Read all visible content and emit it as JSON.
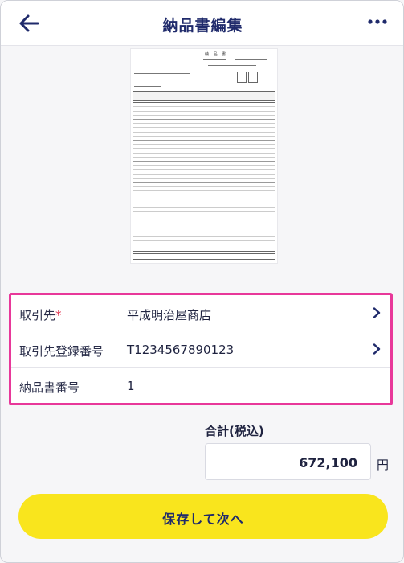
{
  "header": {
    "title": "納品書編集"
  },
  "document_preview": {
    "title": "納 品 書"
  },
  "fields": [
    {
      "label": "取引先",
      "required_mark": "*",
      "value": "平成明治屋商店"
    },
    {
      "label": "取引先登録番号",
      "value": "T1234567890123"
    },
    {
      "label": "納品書番号",
      "value": "1"
    }
  ],
  "total": {
    "label": "合計(税込)",
    "value": "672,100",
    "unit": "円"
  },
  "actions": {
    "save_label": "保存して次へ"
  },
  "colors": {
    "accent_navy": "#1f2a6b",
    "highlight_pink": "#e8389a",
    "button_yellow": "#f9e51d",
    "required_red": "#e02c4a"
  }
}
